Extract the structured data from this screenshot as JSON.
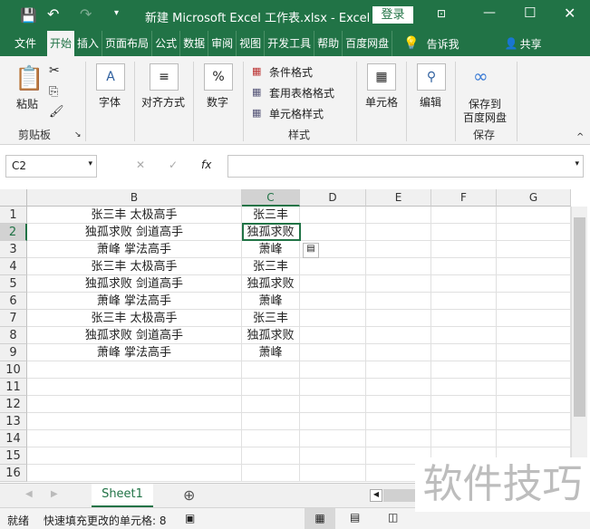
{
  "titlebar": {
    "title": "新建 Microsoft Excel 工作表.xlsx  -  Excel",
    "login": "登录",
    "icons": [
      "save-icon",
      "undo-icon",
      "redo-icon",
      "customize-icon",
      "ribbon-display-icon",
      "minimize-icon",
      "maximize-icon",
      "close-icon"
    ]
  },
  "tabs": [
    "文件",
    "开始",
    "插入",
    "页面布局",
    "公式",
    "数据",
    "审阅",
    "视图",
    "开发工具",
    "帮助",
    "百度网盘"
  ],
  "tell_me": "告诉我",
  "share": "共享",
  "ribbon": {
    "paste": "粘贴",
    "clipboard": "剪贴板",
    "font": "字体",
    "alignment": "对齐方式",
    "number": "数字",
    "cond_format": "条件格式",
    "table_format": "套用表格格式",
    "cell_styles": "单元格样式",
    "styles": "样式",
    "cells": "单元格",
    "editing": "编辑",
    "save_baidu_1": "保存到",
    "save_baidu_2": "百度网盘",
    "save": "保存"
  },
  "formula_bar": {
    "name_box": "C2",
    "formula": "",
    "fx": "fx"
  },
  "columns": [
    "B",
    "C",
    "D",
    "E",
    "F",
    "G"
  ],
  "rows": [
    "1",
    "2",
    "3",
    "4",
    "5",
    "6",
    "7",
    "8",
    "9",
    "10",
    "11",
    "12",
    "13",
    "14",
    "15",
    "16"
  ],
  "colB": [
    "张三丰 太极高手",
    "独孤求败 剑道高手",
    "萧峰 掌法高手",
    "张三丰 太极高手",
    "独孤求败 剑道高手",
    "萧峰 掌法高手",
    "张三丰 太极高手",
    "独孤求败 剑道高手",
    "萧峰 掌法高手"
  ],
  "colC": [
    "张三丰",
    "独孤求败",
    "萧峰",
    "张三丰",
    "独孤求败",
    "萧峰",
    "张三丰",
    "独孤求败",
    "萧峰"
  ],
  "sheet_tab": "Sheet1",
  "status": {
    "ready": "就绪",
    "message": "快速填充更改的单元格: 8"
  },
  "watermark": "软件技巧",
  "accent": "#217346"
}
